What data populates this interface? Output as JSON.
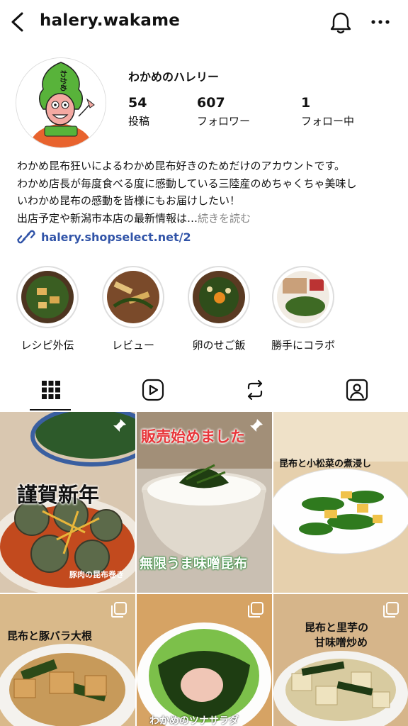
{
  "header": {
    "username": "halery.wakame"
  },
  "profile": {
    "display_name": "わかめのハレリー",
    "avatar_text": "わかめ",
    "stats": [
      {
        "value": "54",
        "label": "投稿"
      },
      {
        "value": "607",
        "label": "フォロワー"
      },
      {
        "value": "1",
        "label": "フォロー中"
      }
    ],
    "bio_lines": [
      "わかめ昆布狂いによるわかめ昆布好きのためだけのアカウントです。",
      "わかめ店長が毎度食べる度に感動している三陸産のめちゃくちゃ美味し",
      "いわかめ昆布の感動を皆様にもお届けしたい！",
      "出店予定や新潟市本店の最新情報は…"
    ],
    "bio_more": "続きを読む",
    "link": "halery.shopselect.net/2"
  },
  "highlights": [
    {
      "label": "レシピ外伝"
    },
    {
      "label": "レビュー"
    },
    {
      "label": "卵のせご飯"
    },
    {
      "label": "勝手にコラボ"
    }
  ],
  "tabs": [
    "grid-icon",
    "reels-icon",
    "repost-icon",
    "tagged-icon"
  ],
  "posts": [
    {
      "title": "謹賀新年",
      "subtitle": "豚肉の昆布巻き"
    },
    {
      "title": "販売始めました",
      "subtitle": "無限うま味噌昆布"
    },
    {
      "title": "昆布と小松菜の煮浸し"
    },
    {
      "title": "昆布と豚バラ大根"
    },
    {
      "title": "わかめのツナサラダ"
    },
    {
      "title": "昆布と里芋の",
      "title2": "甘味噌炒め"
    }
  ],
  "colors": {
    "link": "#3154a8",
    "muted": "#888888",
    "wakame": "#2d6a1e"
  }
}
